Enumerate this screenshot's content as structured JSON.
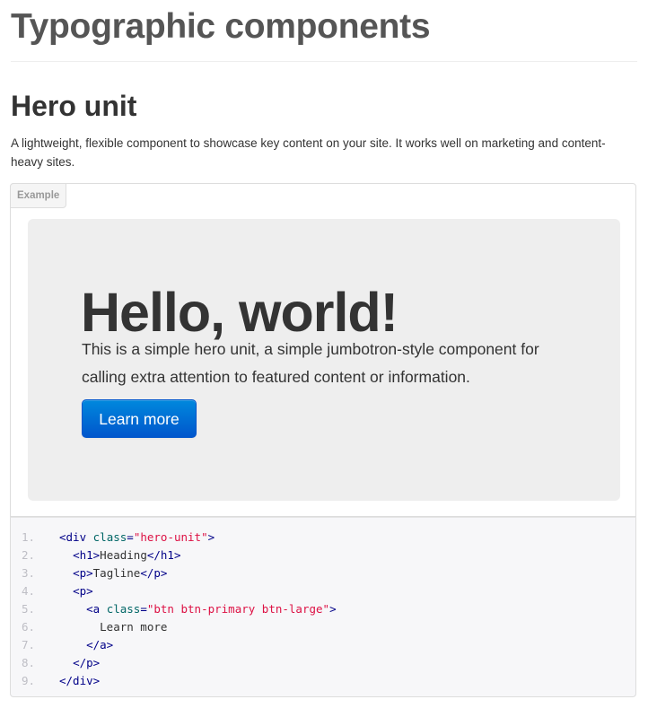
{
  "page": {
    "title": "Typographic components"
  },
  "section": {
    "title": "Hero unit",
    "description": "A lightweight, flexible component to showcase key content on your site. It works well on marketing and content-heavy sites."
  },
  "example": {
    "tag_label": "Example",
    "hero": {
      "heading": "Hello, world!",
      "tagline": "This is a simple hero unit, a simple jumbotron-style component for calling extra attention to featured content or information.",
      "button_label": "Learn more"
    }
  },
  "code": {
    "line_numbers": [
      "1.",
      "2.",
      "3.",
      "4.",
      "5.",
      "6.",
      "7.",
      "8.",
      "9."
    ],
    "lines": [
      [
        {
          "t": "tag",
          "v": "<div "
        },
        {
          "t": "attr",
          "v": "class"
        },
        {
          "t": "tag",
          "v": "="
        },
        {
          "t": "str",
          "v": "\"hero-unit\""
        },
        {
          "t": "tag",
          "v": ">"
        }
      ],
      [
        {
          "t": "pln",
          "v": "  "
        },
        {
          "t": "tag",
          "v": "<h1>"
        },
        {
          "t": "pln",
          "v": "Heading"
        },
        {
          "t": "tag",
          "v": "</h1>"
        }
      ],
      [
        {
          "t": "pln",
          "v": "  "
        },
        {
          "t": "tag",
          "v": "<p>"
        },
        {
          "t": "pln",
          "v": "Tagline"
        },
        {
          "t": "tag",
          "v": "</p>"
        }
      ],
      [
        {
          "t": "pln",
          "v": "  "
        },
        {
          "t": "tag",
          "v": "<p>"
        }
      ],
      [
        {
          "t": "pln",
          "v": "    "
        },
        {
          "t": "tag",
          "v": "<a "
        },
        {
          "t": "attr",
          "v": "class"
        },
        {
          "t": "tag",
          "v": "="
        },
        {
          "t": "str",
          "v": "\"btn btn-primary btn-large\""
        },
        {
          "t": "tag",
          "v": ">"
        }
      ],
      [
        {
          "t": "pln",
          "v": "      Learn more"
        }
      ],
      [
        {
          "t": "pln",
          "v": "    "
        },
        {
          "t": "tag",
          "v": "</a>"
        }
      ],
      [
        {
          "t": "pln",
          "v": "  "
        },
        {
          "t": "tag",
          "v": "</p>"
        }
      ],
      [
        {
          "t": "tag",
          "v": "</div>"
        }
      ]
    ]
  }
}
